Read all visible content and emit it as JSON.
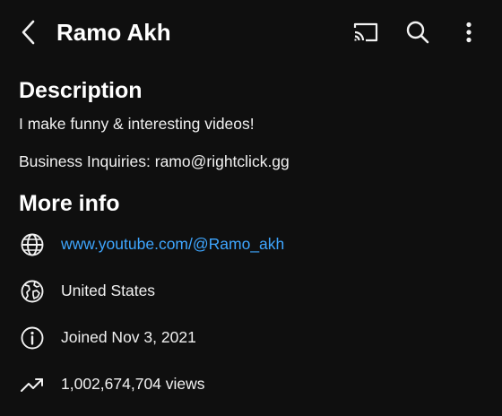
{
  "header": {
    "title": "Ramo Akh",
    "back_icon": "chevron-left-icon",
    "cast_icon": "cast-icon",
    "search_icon": "search-icon",
    "more_icon": "more-vertical-icon"
  },
  "description": {
    "heading": "Description",
    "line1": "I make funny & interesting videos!",
    "line2": "Business Inquiries: ramo@rightclick.gg"
  },
  "more_info": {
    "heading": "More info",
    "items": [
      {
        "icon": "globe-icon",
        "text": "www.youtube.com/@Ramo_akh"
      },
      {
        "icon": "location-globe-icon",
        "text": "United States"
      },
      {
        "icon": "info-icon",
        "text": "Joined Nov 3, 2021"
      },
      {
        "icon": "trending-up-icon",
        "text": "1,002,674,704 views"
      }
    ]
  },
  "colors": {
    "background": "#0f0f0f",
    "text": "#f1f1f1",
    "link": "#3ea6ff"
  }
}
